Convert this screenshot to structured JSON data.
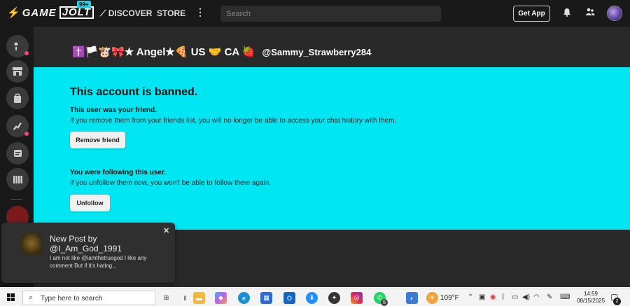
{
  "topnav": {
    "logo_game": "GAME",
    "logo_jolt": "JOLT",
    "notif_badge": "99+",
    "discover": "DISCOVER",
    "store": "STORE",
    "more": "⋮",
    "search_placeholder": "Search",
    "get_app": "Get App"
  },
  "profile": {
    "display_name": "✝️🏳️🐮🎀★ Angel★🍕 US 🤝 CA 🍓",
    "username": "@Sammy_Strawberry284"
  },
  "banned": {
    "title": "This account is banned.",
    "friend_label": "This user was your friend.",
    "friend_text": "If you remove them from your friends list, you will no longer be able to access your chat history with them.",
    "remove_friend": "Remove friend",
    "follow_label": "You were following this user.",
    "follow_text": "If you unfollow them now, you won't be able to follow them again.",
    "unfollow": "Unfollow"
  },
  "toast": {
    "title": "New Post by",
    "user": "@I_Am_God_1991",
    "body": "I am not like @iamthetruegod I like any comment But if it's hating...",
    "close": "✕"
  },
  "taskbar": {
    "search_text": "Type here to search",
    "weather": "109°F",
    "time": "14:59",
    "date": "08/15/2025",
    "notif_count": "2",
    "whatsapp_badge": "5"
  },
  "colors": {
    "banned_bg": "#00e7f3",
    "dark_bg": "#191919",
    "main_bg": "#292929",
    "badge": "#1dd1e6",
    "sidebar_dot": "#ff3d7f"
  }
}
